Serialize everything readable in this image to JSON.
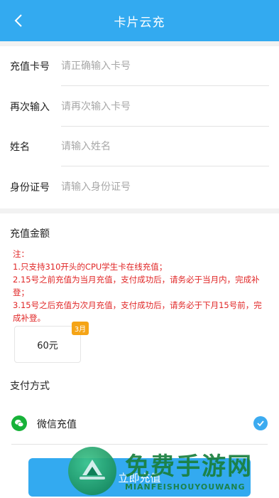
{
  "header": {
    "title": "卡片云充"
  },
  "form": {
    "rows": [
      {
        "label": "充值卡号",
        "placeholder": "请正确输入卡号"
      },
      {
        "label": "再次输入",
        "placeholder": "请再次输入卡号"
      },
      {
        "label": "姓名",
        "placeholder": "请输入姓名"
      },
      {
        "label": "身份证号",
        "placeholder": "请输入身份证号"
      }
    ]
  },
  "amount": {
    "title": "充值金额",
    "notice": [
      "注：",
      "1.只支持310开头的CPU学生卡在线充值；",
      "2.15号之前充值为当月充值，支付成功后，请务必于当月内，完成补登；",
      "3.15号之后充值为次月充值，支付成功后，请务必于下月15号前，完成补登。"
    ],
    "option": {
      "value": "60元",
      "badge": "3月"
    }
  },
  "payment": {
    "title": "支付方式",
    "method": "微信充值",
    "method_icon": "wechat-icon",
    "selected": true
  },
  "submit_label": "立即充值",
  "watermark": {
    "text": "免费手游网",
    "subtext": "MIANFEISHOUYOUWANG"
  },
  "colors": {
    "primary": "#33aaf0",
    "notice": "#e02626",
    "badge": "#f5a416",
    "wechat": "#17b239"
  }
}
